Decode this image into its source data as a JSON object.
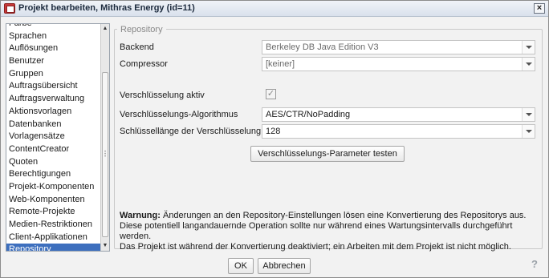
{
  "window": {
    "title": "Projekt bearbeiten, Mithras Energy (id=11)",
    "close_glyph": "×"
  },
  "sidebar": {
    "items": [
      {
        "label": "Farbe"
      },
      {
        "label": "Sprachen"
      },
      {
        "label": "Auflösungen"
      },
      {
        "label": "Benutzer"
      },
      {
        "label": "Gruppen"
      },
      {
        "label": "Auftragsübersicht"
      },
      {
        "label": "Auftragsverwaltung"
      },
      {
        "label": "Aktionsvorlagen"
      },
      {
        "label": "Datenbanken"
      },
      {
        "label": "Vorlagensätze"
      },
      {
        "label": "ContentCreator"
      },
      {
        "label": "Quoten"
      },
      {
        "label": "Berechtigungen"
      },
      {
        "label": "Projekt-Komponenten"
      },
      {
        "label": "Web-Komponenten"
      },
      {
        "label": "Remote-Projekte"
      },
      {
        "label": "Medien-Restriktionen"
      },
      {
        "label": "Client-Applikationen"
      },
      {
        "label": "Repository"
      }
    ],
    "selected": "Repository"
  },
  "repository": {
    "group_title": "Repository",
    "backend_label": "Backend",
    "backend_value": "Berkeley DB Java Edition V3",
    "compressor_label": "Compressor",
    "compressor_value": "[keiner]",
    "encryption_active_label": "Verschlüsselung aktiv",
    "encryption_active_checked": true,
    "algorithm_label": "Verschlüsselungs-Algorithmus",
    "algorithm_value": "AES/CTR/NoPadding",
    "keylength_label": "Schlüssellänge der Verschlüsselung",
    "keylength_value": "128",
    "test_button": "Verschlüsselungs-Parameter testen",
    "warning_bold": "Warnung:",
    "warning_line1": " Änderungen an den Repository-Einstellungen lösen eine Konvertierung des Repositorys aus.",
    "warning_line2": "Diese potentiell langandauernde Operation sollte nur während eines Wartungsintervalls durchgeführt werden.",
    "warning_line3": "Das Projekt ist während der Konvertierung deaktiviert; ein Arbeiten mit dem Projekt ist nicht möglich."
  },
  "footer": {
    "ok_label": "OK",
    "cancel_label": "Abbrechen",
    "help_glyph": "?"
  }
}
